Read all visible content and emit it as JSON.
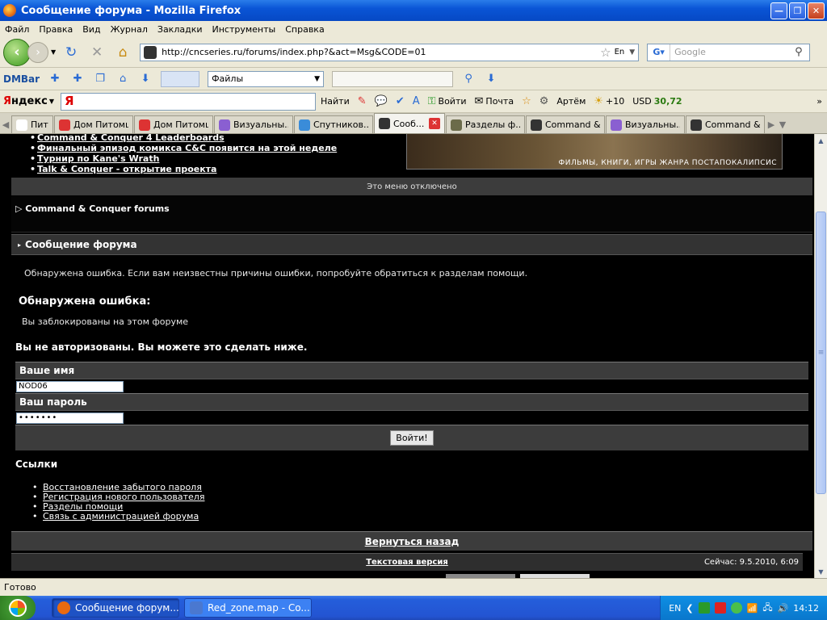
{
  "window": {
    "title": "Сообщение форума - Mozilla Firefox",
    "min": "—",
    "max": "❐",
    "close": "✕"
  },
  "menu": [
    "Файл",
    "Правка",
    "Вид",
    "Журнал",
    "Закладки",
    "Инструменты",
    "Справка"
  ],
  "nav": {
    "url": "http://cncseries.ru/forums/index.php?&act=Msg&CODE=01",
    "search_placeholder": "Google",
    "search_engine_icon": "google-icon",
    "lang": "En"
  },
  "dmbar": {
    "logo": "DMBar",
    "files_label": "Файлы"
  },
  "yandex": {
    "logo_prefix": "Я",
    "logo_rest": "ндекс",
    "input_value": "Я",
    "find": "Найти",
    "login": "Войти",
    "mail": "Почта",
    "user": "Артём",
    "weather": "+10",
    "usd_label": "USD",
    "usd_value": "30,72"
  },
  "tabs": [
    {
      "label": "Питомца",
      "color": "#ffffff",
      "active": false
    },
    {
      "label": "Дом Питомца",
      "color": "#d33",
      "active": false
    },
    {
      "label": "Дом Питомца",
      "color": "#d33",
      "active": false
    },
    {
      "label": "Визуальны...",
      "color": "#8a5fd1",
      "active": false
    },
    {
      "label": "Спутников...",
      "color": "#3a8cd9",
      "active": false
    },
    {
      "label": "Сооб...",
      "color": "#333",
      "active": true
    },
    {
      "label": "Разделы ф...",
      "color": "#6b6b4a",
      "active": false
    },
    {
      "label": "Command &...",
      "color": "#333",
      "active": false
    },
    {
      "label": "Визуальны...",
      "color": "#8a5fd1",
      "active": false
    },
    {
      "label": "Command &...",
      "color": "#333",
      "active": false
    }
  ],
  "page": {
    "news": [
      "Command & Conquer 4 Leaderboards",
      "Финальный эпизод комикса C&C появится на этой неделе",
      "Турнир по Kane's Wrath",
      "Talk & Conquer - открытие проекта"
    ],
    "banner_text": "ФИЛЬМЫ, КНИГИ, ИГРЫ ЖАНРА ПОСТАПОКАЛИПСИС",
    "menu_disabled": "Это меню отключено",
    "forums_link": "Command & Conquer forums",
    "section_title": "Сообщение форума",
    "error_message": "Обнаружена ошибка. Если вам неизвестны причины ошибки, попробуйте обратиться к разделам помощи.",
    "error_title": "Обнаружена ошибка:",
    "error_text": "Вы заблокированы на этом форуме",
    "not_authorized": "Вы не авторизованы. Вы можете это сделать ниже.",
    "username_label": "Ваше имя",
    "username_value": "NOD06",
    "password_label": "Ваш пароль",
    "password_value": "•••••••",
    "submit_label": "Войти!",
    "links_title": "Ссылки",
    "links": [
      "Восстановление забытого пароля",
      "Регистрация нового пользователя",
      "Разделы помощи",
      "Связь с администрацией форума"
    ],
    "back_link": "Вернуться назад",
    "text_version": "Текстовая версия",
    "now": "Сейчас: 9.5.2010, 6:09"
  },
  "status": "Готово",
  "taskbar": {
    "tasks": [
      {
        "label": "Сообщение форум...",
        "active": true,
        "color": "#e86a10"
      },
      {
        "label": "Red_zone.map - Co...",
        "active": false,
        "color": "#4a78d0"
      }
    ],
    "lang": "EN",
    "clock": "14:12"
  }
}
